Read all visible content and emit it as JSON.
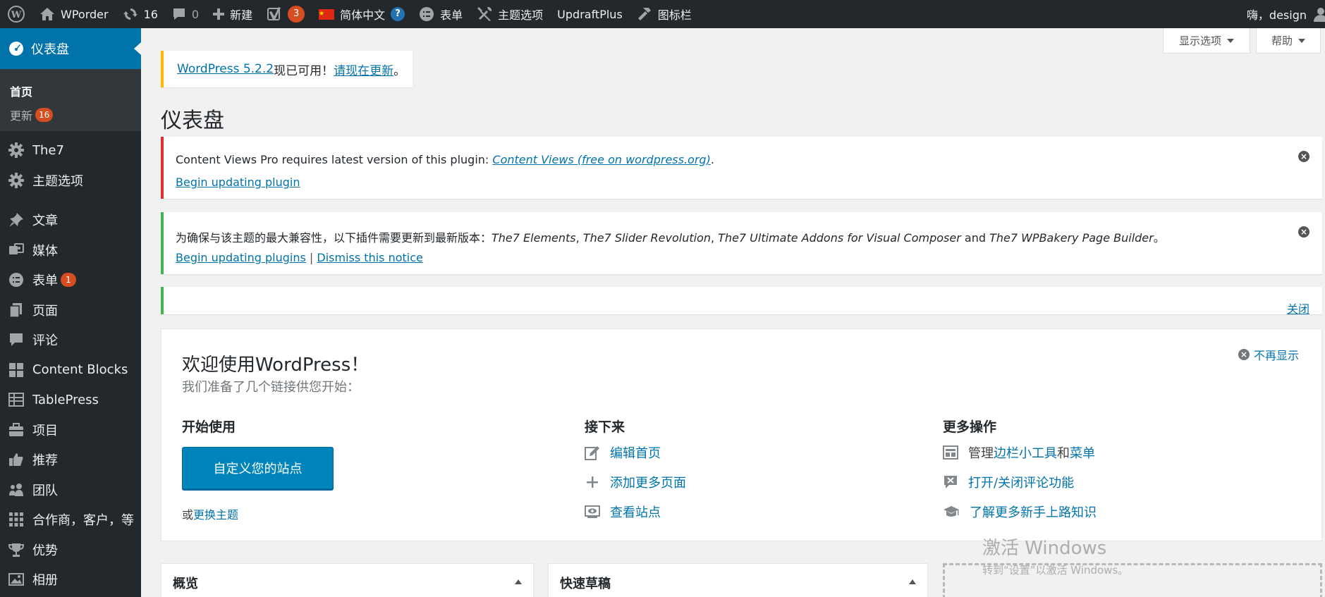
{
  "adminbar": {
    "site_name": "WPorder",
    "updates_count": "16",
    "comments_count": "0",
    "new_label": "新建",
    "yoast_badge": "3",
    "language_label": "简体中文",
    "language_help": "?",
    "forms_label": "表单",
    "theme_options_label": "主题选项",
    "updraft_label": "UpdraftPlus",
    "icon_bar_label": "图标栏",
    "howdy": "嗨，design"
  },
  "sidebar": {
    "current": "仪表盘",
    "submenu": [
      {
        "label": "首页"
      },
      {
        "label": "更新",
        "badge": "16"
      }
    ],
    "items": [
      {
        "label": "The7",
        "icon": "gear-icon"
      },
      {
        "label": "主题选项",
        "icon": "gear-icon"
      },
      {
        "label": "文章",
        "icon": "pin-icon"
      },
      {
        "label": "媒体",
        "icon": "media-icon"
      },
      {
        "label": "表单",
        "icon": "forms-icon",
        "badge": "1"
      },
      {
        "label": "页面",
        "icon": "pages-icon"
      },
      {
        "label": "评论",
        "icon": "comment-icon"
      },
      {
        "label": "Content Blocks",
        "icon": "grid-icon"
      },
      {
        "label": "TablePress",
        "icon": "table-icon"
      },
      {
        "label": "项目",
        "icon": "briefcase-icon"
      },
      {
        "label": "推荐",
        "icon": "thumbs-up-icon"
      },
      {
        "label": "团队",
        "icon": "team-icon"
      },
      {
        "label": "合作商，客户，等",
        "icon": "grid-icon"
      },
      {
        "label": "优势",
        "icon": "trophy-icon"
      },
      {
        "label": "相册",
        "icon": "gallery-icon"
      }
    ]
  },
  "screen_meta": {
    "options_label": "显示选项",
    "help_label": "帮助"
  },
  "update_nag": {
    "version_link": "WordPress 5.2.2",
    "middle": "现已可用！",
    "update_link": "请现在更新",
    "end": "。"
  },
  "page_title": "仪表盘",
  "notice_content_views": {
    "text": "Content Views Pro requires latest version of this plugin: ",
    "plugin_link": "Content Views (free on wordpress.org)",
    "period": ".",
    "action_link": "Begin updating plugin",
    "dismiss": "×"
  },
  "notice_the7": {
    "prefix": "为确保与该主题的最大兼容性，以下插件需要更新到最新版本：",
    "plugin1": "The7 Elements",
    "sep1": ", ",
    "plugin2": "The7 Slider Revolution",
    "sep2": ", ",
    "plugin3": "The7 Ultimate Addons for Visual Composer",
    "and": " and ",
    "plugin4": "The7 WPBakery Page Builder",
    "suffix": "。",
    "link_update": "Begin updating plugins",
    "divider": "|",
    "link_dismiss": "Dismiss this notice",
    "dismiss": "×"
  },
  "notice_empty": {
    "close_link": "关闭"
  },
  "welcome": {
    "title": "欢迎使用WordPress！",
    "about": "我们准备了几个链接供您开始：",
    "dismiss_label": "不再显示",
    "dismiss_icon": "×",
    "col1_title": "开始使用",
    "customize_button": "自定义您的站点",
    "or_text": "或",
    "change_theme_link": "更换主题",
    "col2_title": "接下来",
    "next_steps": [
      {
        "label": "编辑首页",
        "icon": "edit-icon"
      },
      {
        "label": "添加更多页面",
        "icon": "plus-icon"
      },
      {
        "label": "查看站点",
        "icon": "view-site-icon"
      }
    ],
    "col3_title": "更多操作",
    "manage_prefix": "管理",
    "manage_widgets": "边栏小工具",
    "manage_and": "和",
    "manage_menus": "菜单",
    "comments_toggle": "打开/关闭评论功能",
    "learn_more": "了解更多新手上路知识"
  },
  "widgets": {
    "overview_title": "概览",
    "quick_draft_title": "快速草稿"
  },
  "watermark": {
    "line1": "激活 Windows",
    "line2": "转到“设置”以激活 Windows。"
  },
  "colors": {
    "adminbar_bg": "#23282d",
    "accent": "#0073aa",
    "badge": "#d54e21",
    "notice_warning": "#ffb900",
    "notice_error": "#dc3232",
    "notice_success": "#46b450",
    "button": "#0085ba"
  }
}
